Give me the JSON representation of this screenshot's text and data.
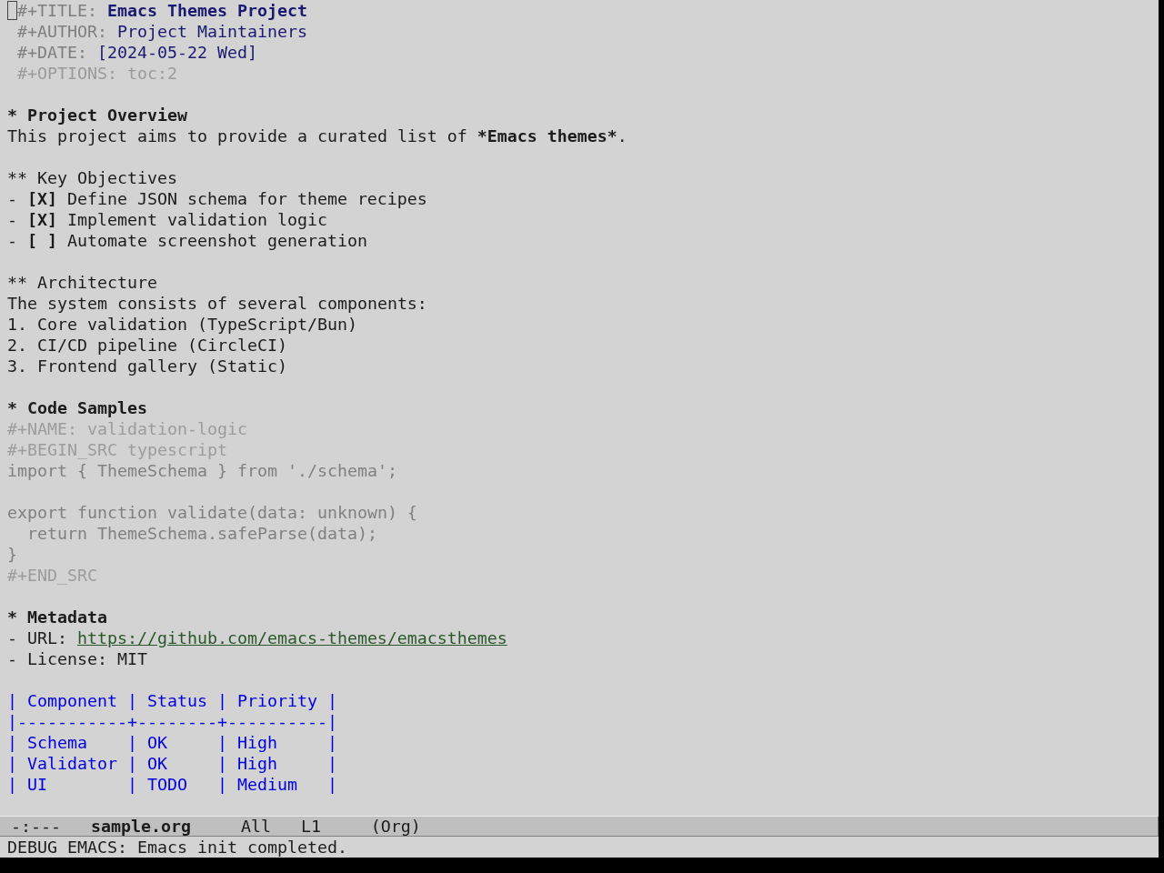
{
  "header": [
    {
      "kind": "title",
      "keyword": "#+TITLE:",
      "value": "Emacs Themes Project"
    },
    {
      "kind": "meta",
      "keyword": "#+AUTHOR:",
      "value": "Project Maintainers"
    },
    {
      "kind": "meta",
      "keyword": "#+DATE:",
      "value": "[2024-05-22 Wed]"
    },
    {
      "kind": "option",
      "keyword": "#+OPTIONS:",
      "value": "toc:2"
    }
  ],
  "sections": [
    {
      "heading": "* Project Overview",
      "body": [
        {
          "kind": "paragraph",
          "parts": [
            {
              "kind": "plain",
              "text": "This project aims to provide a curated list of "
            },
            {
              "kind": "bold",
              "text": "*Emacs themes*"
            },
            {
              "kind": "plain",
              "text": "."
            }
          ]
        }
      ],
      "children": [
        {
          "heading": "** Key Objectives",
          "body": [
            {
              "kind": "checklist",
              "items": [
                {
                  "marker": "-",
                  "checkbox": "[X]",
                  "text": "Define JSON schema for theme recipes"
                },
                {
                  "marker": "-",
                  "checkbox": "[X]",
                  "text": "Implement validation logic"
                },
                {
                  "marker": "-",
                  "checkbox": "[ ]",
                  "text": "Automate screenshot generation"
                }
              ]
            }
          ]
        },
        {
          "heading": "** Architecture",
          "body": [
            {
              "kind": "paragraph",
              "parts": [
                {
                  "kind": "plain",
                  "text": "The system consists of several components:"
                }
              ]
            },
            {
              "kind": "ordered_list",
              "items": [
                {
                  "number": "1.",
                  "text": "Core validation (TypeScript/Bun)"
                },
                {
                  "number": "2.",
                  "text": "CI/CD pipeline (CircleCI)"
                },
                {
                  "number": "3.",
                  "text": "Frontend gallery (Static)"
                }
              ]
            }
          ]
        }
      ]
    },
    {
      "heading": "* Code Samples",
      "body": [
        {
          "kind": "src_block",
          "name_line": "#+NAME: validation-logic",
          "begin_line": "#+BEGIN_SRC typescript",
          "groups": [
            [
              "import { ThemeSchema } from './schema';"
            ],
            [
              "export function validate(data: unknown) {",
              "  return ThemeSchema.safeParse(data);",
              "}"
            ]
          ],
          "end_line": "#+END_SRC"
        }
      ]
    },
    {
      "heading": "* Metadata",
      "body": [
        {
          "kind": "bullet_list",
          "items": [
            {
              "kind": "link",
              "marker": "-",
              "label": "URL:",
              "url": "https://github.com/emacs-themes/emacsthemes"
            },
            {
              "kind": "text",
              "marker": "-",
              "text": "License: MIT"
            }
          ]
        },
        {
          "kind": "table",
          "header": "| Component | Status | Priority |",
          "rule": "|-----------+--------+----------|",
          "rows": [
            "| Schema    | OK     | High     |",
            "| Validator | OK     | High     |",
            "| UI        | TODO   | Medium   |"
          ]
        }
      ]
    }
  ],
  "mode_line": {
    "status": "-:---",
    "buffer_name": "sample.org",
    "position": "All",
    "line": "L1",
    "mode": "(Org)"
  },
  "echo_area": "DEBUG EMACS: Emacs init completed."
}
